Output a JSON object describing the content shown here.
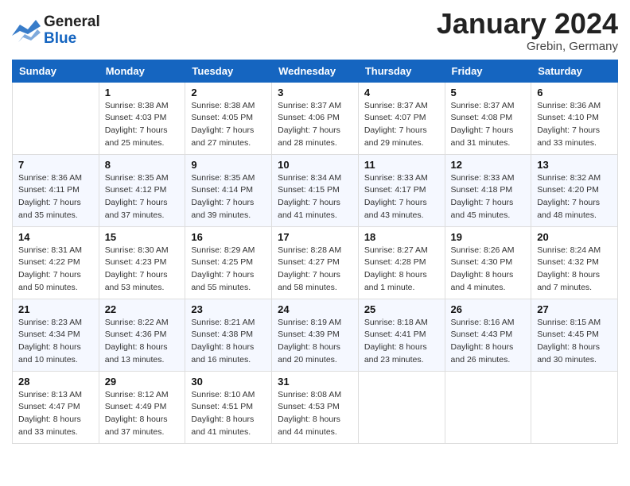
{
  "logo": {
    "general": "General",
    "blue": "Blue"
  },
  "title": "January 2024",
  "location": "Grebin, Germany",
  "days_of_week": [
    "Sunday",
    "Monday",
    "Tuesday",
    "Wednesday",
    "Thursday",
    "Friday",
    "Saturday"
  ],
  "weeks": [
    [
      {
        "day": "",
        "sunrise": "",
        "sunset": "",
        "daylight": ""
      },
      {
        "day": "1",
        "sunrise": "Sunrise: 8:38 AM",
        "sunset": "Sunset: 4:03 PM",
        "daylight": "Daylight: 7 hours and 25 minutes."
      },
      {
        "day": "2",
        "sunrise": "Sunrise: 8:38 AM",
        "sunset": "Sunset: 4:05 PM",
        "daylight": "Daylight: 7 hours and 27 minutes."
      },
      {
        "day": "3",
        "sunrise": "Sunrise: 8:37 AM",
        "sunset": "Sunset: 4:06 PM",
        "daylight": "Daylight: 7 hours and 28 minutes."
      },
      {
        "day": "4",
        "sunrise": "Sunrise: 8:37 AM",
        "sunset": "Sunset: 4:07 PM",
        "daylight": "Daylight: 7 hours and 29 minutes."
      },
      {
        "day": "5",
        "sunrise": "Sunrise: 8:37 AM",
        "sunset": "Sunset: 4:08 PM",
        "daylight": "Daylight: 7 hours and 31 minutes."
      },
      {
        "day": "6",
        "sunrise": "Sunrise: 8:36 AM",
        "sunset": "Sunset: 4:10 PM",
        "daylight": "Daylight: 7 hours and 33 minutes."
      }
    ],
    [
      {
        "day": "7",
        "sunrise": "Sunrise: 8:36 AM",
        "sunset": "Sunset: 4:11 PM",
        "daylight": "Daylight: 7 hours and 35 minutes."
      },
      {
        "day": "8",
        "sunrise": "Sunrise: 8:35 AM",
        "sunset": "Sunset: 4:12 PM",
        "daylight": "Daylight: 7 hours and 37 minutes."
      },
      {
        "day": "9",
        "sunrise": "Sunrise: 8:35 AM",
        "sunset": "Sunset: 4:14 PM",
        "daylight": "Daylight: 7 hours and 39 minutes."
      },
      {
        "day": "10",
        "sunrise": "Sunrise: 8:34 AM",
        "sunset": "Sunset: 4:15 PM",
        "daylight": "Daylight: 7 hours and 41 minutes."
      },
      {
        "day": "11",
        "sunrise": "Sunrise: 8:33 AM",
        "sunset": "Sunset: 4:17 PM",
        "daylight": "Daylight: 7 hours and 43 minutes."
      },
      {
        "day": "12",
        "sunrise": "Sunrise: 8:33 AM",
        "sunset": "Sunset: 4:18 PM",
        "daylight": "Daylight: 7 hours and 45 minutes."
      },
      {
        "day": "13",
        "sunrise": "Sunrise: 8:32 AM",
        "sunset": "Sunset: 4:20 PM",
        "daylight": "Daylight: 7 hours and 48 minutes."
      }
    ],
    [
      {
        "day": "14",
        "sunrise": "Sunrise: 8:31 AM",
        "sunset": "Sunset: 4:22 PM",
        "daylight": "Daylight: 7 hours and 50 minutes."
      },
      {
        "day": "15",
        "sunrise": "Sunrise: 8:30 AM",
        "sunset": "Sunset: 4:23 PM",
        "daylight": "Daylight: 7 hours and 53 minutes."
      },
      {
        "day": "16",
        "sunrise": "Sunrise: 8:29 AM",
        "sunset": "Sunset: 4:25 PM",
        "daylight": "Daylight: 7 hours and 55 minutes."
      },
      {
        "day": "17",
        "sunrise": "Sunrise: 8:28 AM",
        "sunset": "Sunset: 4:27 PM",
        "daylight": "Daylight: 7 hours and 58 minutes."
      },
      {
        "day": "18",
        "sunrise": "Sunrise: 8:27 AM",
        "sunset": "Sunset: 4:28 PM",
        "daylight": "Daylight: 8 hours and 1 minute."
      },
      {
        "day": "19",
        "sunrise": "Sunrise: 8:26 AM",
        "sunset": "Sunset: 4:30 PM",
        "daylight": "Daylight: 8 hours and 4 minutes."
      },
      {
        "day": "20",
        "sunrise": "Sunrise: 8:24 AM",
        "sunset": "Sunset: 4:32 PM",
        "daylight": "Daylight: 8 hours and 7 minutes."
      }
    ],
    [
      {
        "day": "21",
        "sunrise": "Sunrise: 8:23 AM",
        "sunset": "Sunset: 4:34 PM",
        "daylight": "Daylight: 8 hours and 10 minutes."
      },
      {
        "day": "22",
        "sunrise": "Sunrise: 8:22 AM",
        "sunset": "Sunset: 4:36 PM",
        "daylight": "Daylight: 8 hours and 13 minutes."
      },
      {
        "day": "23",
        "sunrise": "Sunrise: 8:21 AM",
        "sunset": "Sunset: 4:38 PM",
        "daylight": "Daylight: 8 hours and 16 minutes."
      },
      {
        "day": "24",
        "sunrise": "Sunrise: 8:19 AM",
        "sunset": "Sunset: 4:39 PM",
        "daylight": "Daylight: 8 hours and 20 minutes."
      },
      {
        "day": "25",
        "sunrise": "Sunrise: 8:18 AM",
        "sunset": "Sunset: 4:41 PM",
        "daylight": "Daylight: 8 hours and 23 minutes."
      },
      {
        "day": "26",
        "sunrise": "Sunrise: 8:16 AM",
        "sunset": "Sunset: 4:43 PM",
        "daylight": "Daylight: 8 hours and 26 minutes."
      },
      {
        "day": "27",
        "sunrise": "Sunrise: 8:15 AM",
        "sunset": "Sunset: 4:45 PM",
        "daylight": "Daylight: 8 hours and 30 minutes."
      }
    ],
    [
      {
        "day": "28",
        "sunrise": "Sunrise: 8:13 AM",
        "sunset": "Sunset: 4:47 PM",
        "daylight": "Daylight: 8 hours and 33 minutes."
      },
      {
        "day": "29",
        "sunrise": "Sunrise: 8:12 AM",
        "sunset": "Sunset: 4:49 PM",
        "daylight": "Daylight: 8 hours and 37 minutes."
      },
      {
        "day": "30",
        "sunrise": "Sunrise: 8:10 AM",
        "sunset": "Sunset: 4:51 PM",
        "daylight": "Daylight: 8 hours and 41 minutes."
      },
      {
        "day": "31",
        "sunrise": "Sunrise: 8:08 AM",
        "sunset": "Sunset: 4:53 PM",
        "daylight": "Daylight: 8 hours and 44 minutes."
      },
      {
        "day": "",
        "sunrise": "",
        "sunset": "",
        "daylight": ""
      },
      {
        "day": "",
        "sunrise": "",
        "sunset": "",
        "daylight": ""
      },
      {
        "day": "",
        "sunrise": "",
        "sunset": "",
        "daylight": ""
      }
    ]
  ]
}
